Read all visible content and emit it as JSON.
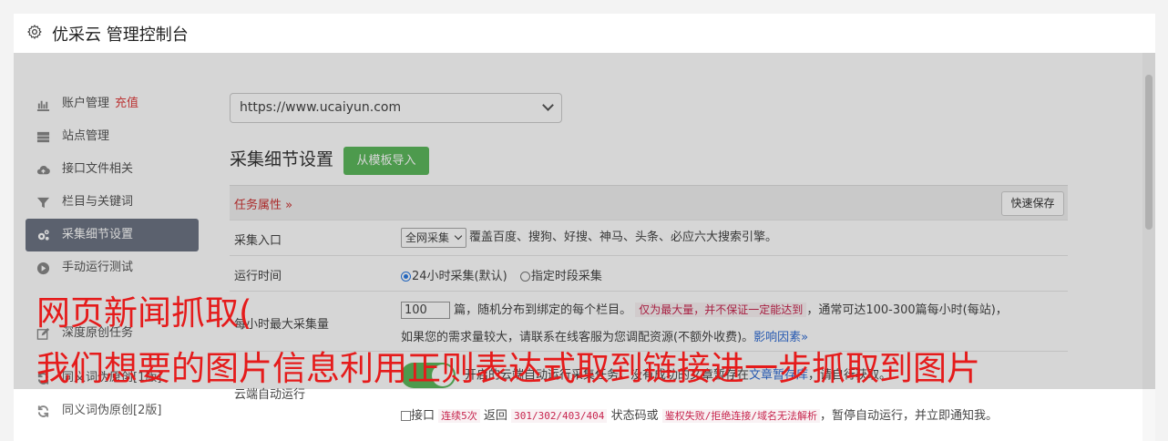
{
  "header": {
    "title": "优采云 管理控制台",
    "icon": "gear-icon"
  },
  "sidebar": {
    "items": [
      {
        "label": "账户管理",
        "extra": "充值",
        "icon": "bar-chart-icon"
      },
      {
        "label": "站点管理",
        "icon": "server-icon"
      },
      {
        "label": "接口文件相关",
        "icon": "cloud-upload-icon"
      },
      {
        "label": "栏目与关键词",
        "icon": "filter-icon"
      },
      {
        "label": "采集细节设置",
        "icon": "cogs-icon",
        "active": true
      },
      {
        "label": "手动运行测试",
        "icon": "play-circle-icon"
      },
      {
        "label": "深度原创任务",
        "icon": "edit-icon"
      },
      {
        "label": "同义词伪原创[1版]",
        "icon": "refresh-icon"
      },
      {
        "label": "同义词伪原创[2版]",
        "icon": "refresh-icon"
      }
    ]
  },
  "main": {
    "site_select": "https://www.ucaiyun.com",
    "section_title": "采集细节设置",
    "import_button": "从模板导入",
    "task_attr": "任务属性 »",
    "quick_save": "快速保存",
    "rows": {
      "entry": {
        "label": "采集入口",
        "select": "全网采集",
        "desc": "覆盖百度、搜狗、好搜、神马、头条、必应六大搜索引擎。"
      },
      "time": {
        "label": "运行时间",
        "opt1": "24小时采集(默认)",
        "opt2": "指定时段采集"
      },
      "max": {
        "label": "每小时最大采集量",
        "value": "100",
        "desc1": "篇，随机分布到绑定的每个栏目。",
        "warn": "仅为最大量，并不保证一定能达到",
        "desc2": "，通常可达100-300篇每小时(每站)，",
        "desc3": "如果您的需求量较大，请联系在线客服为您调配资源(不额外收费)。",
        "link": "影响因素»"
      },
      "cloud": {
        "label": "云端自动运行",
        "desc1": "开启的云端自动运行采集任务。没有成功的文章暂存在",
        "link": "文章暂存库",
        "desc2": "，请自行获取。",
        "c_pre": "接口",
        "c_code1": "连续5次",
        "c_mid1": "返回",
        "c_code2": "301/302/403/404",
        "c_mid2": "状态码或",
        "c_code3": "鉴权失败/拒绝连接/域名无法解析",
        "c_end": "，暂停自动运行，并立即通知我。"
      }
    }
  },
  "caption": {
    "line1": "网页新闻抓取(",
    "line2": "我们想要的图片信息利用正则表达式取到链接进一步抓取到图片"
  }
}
